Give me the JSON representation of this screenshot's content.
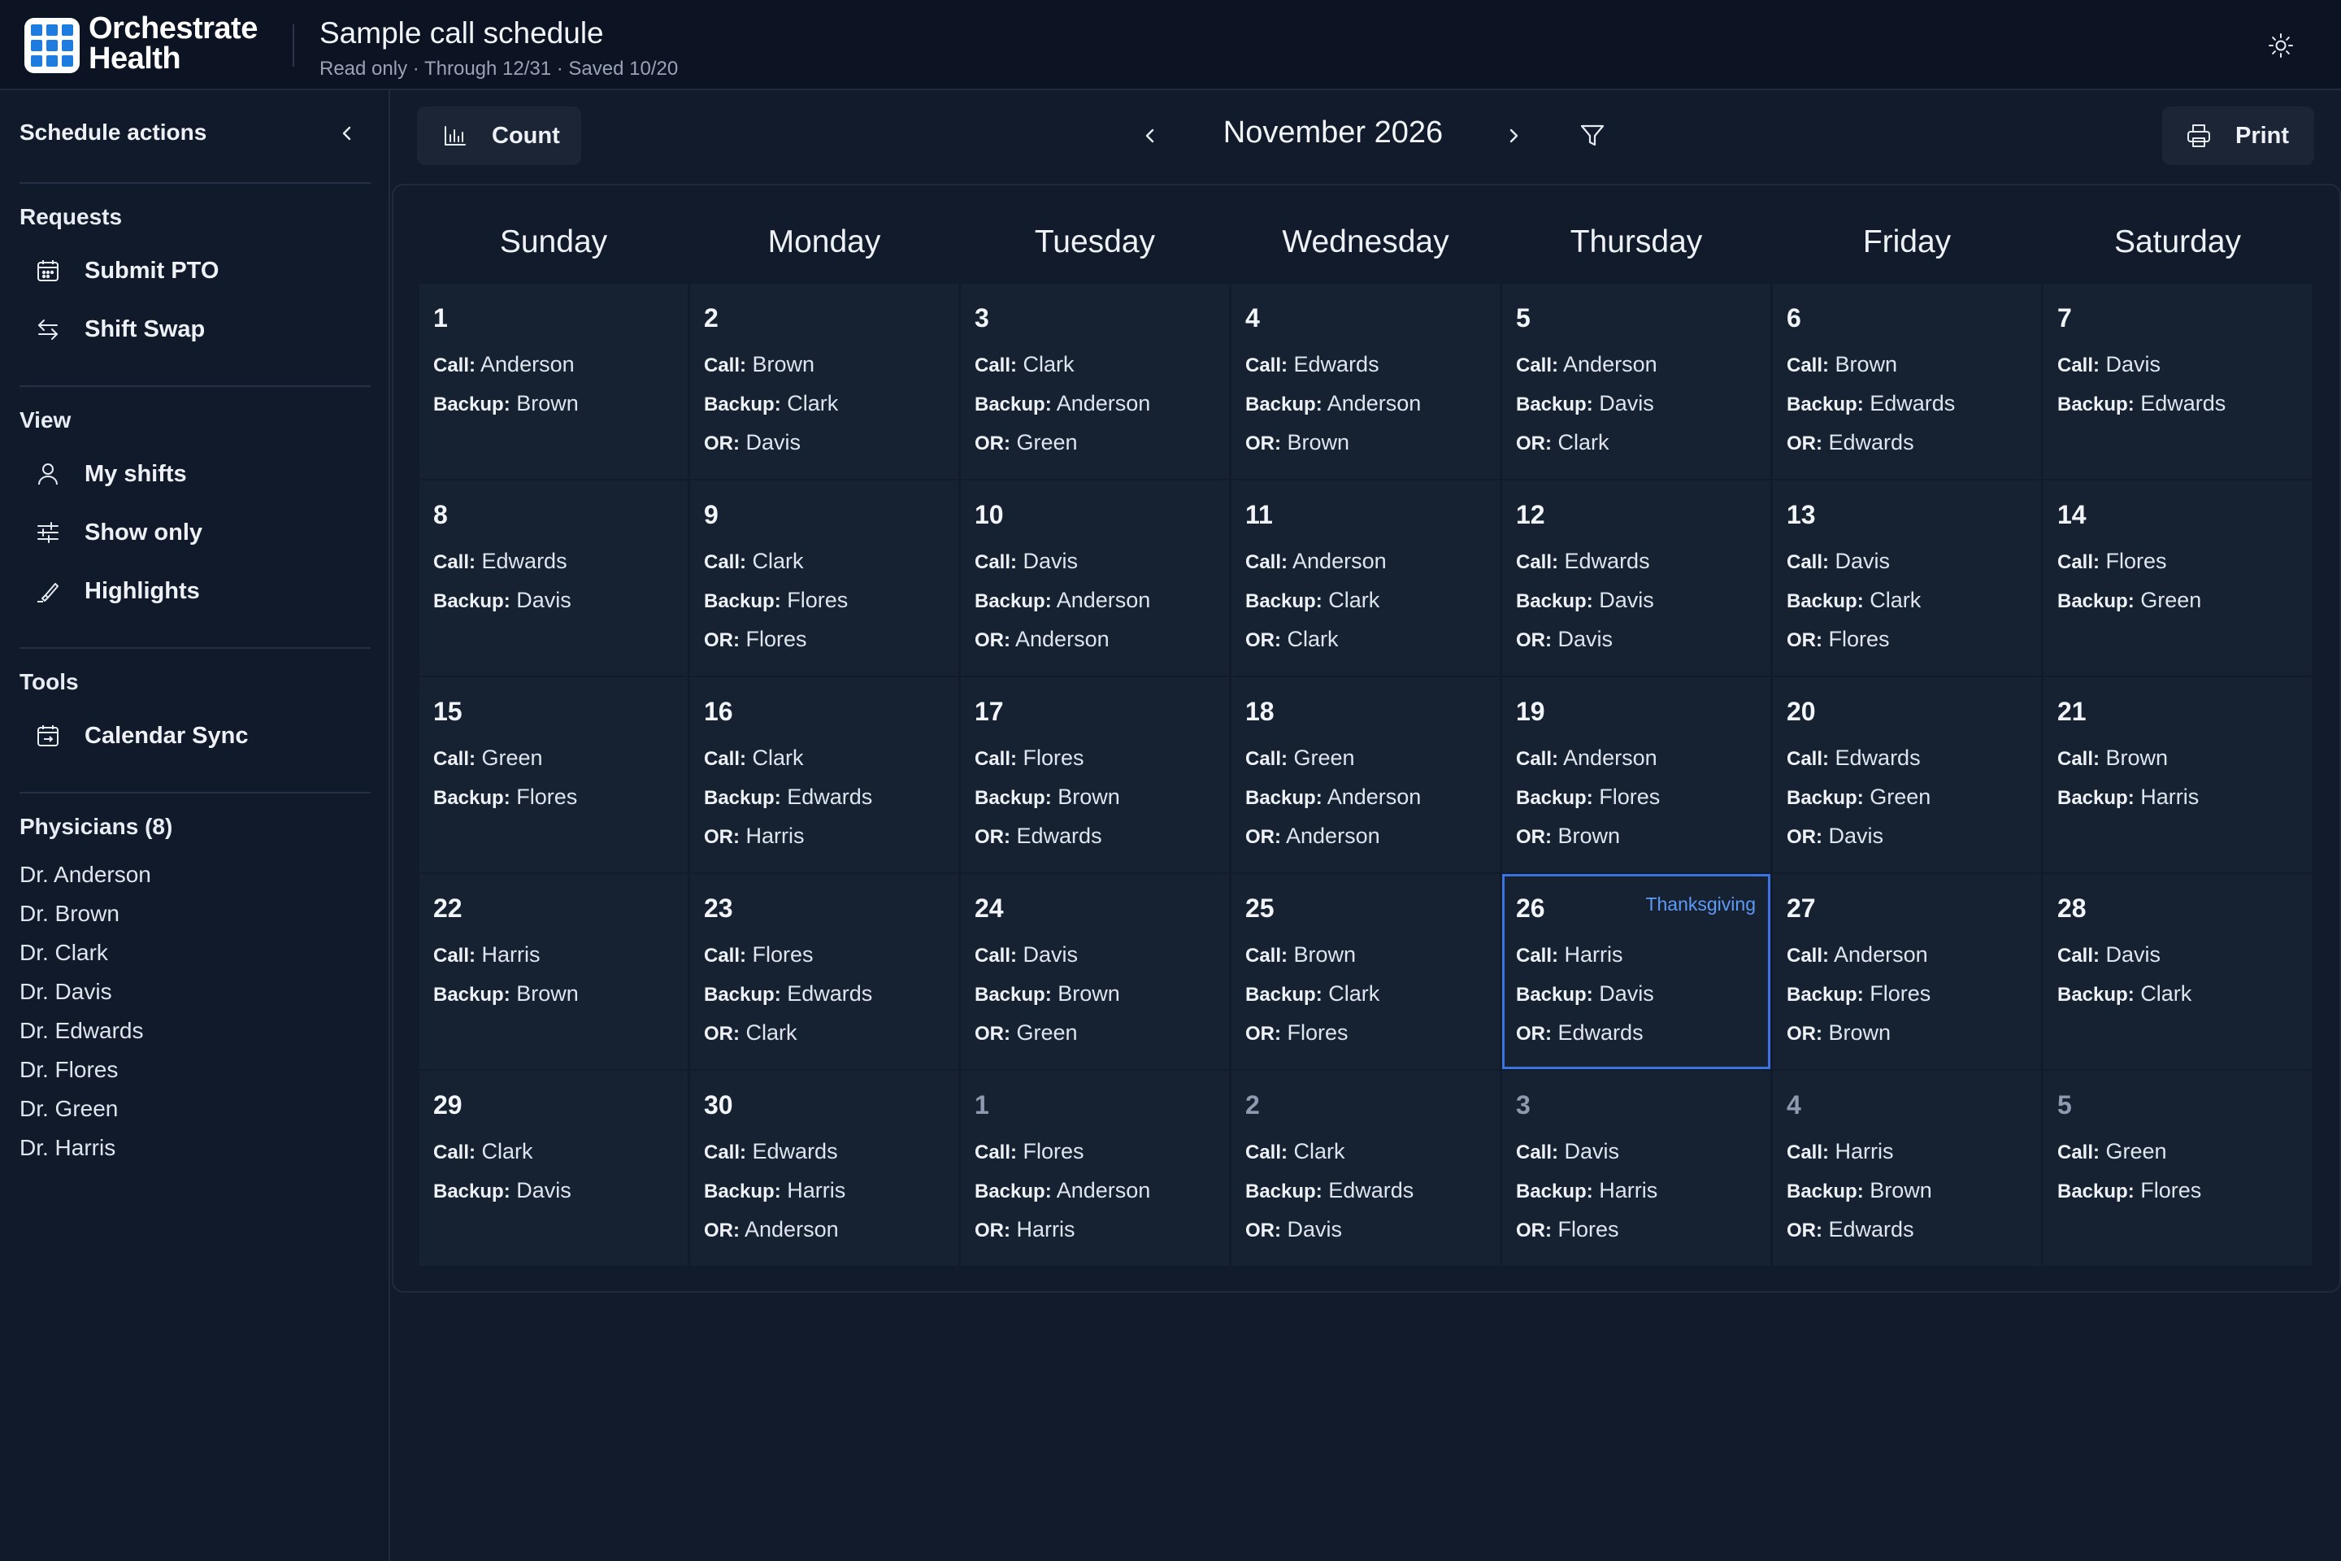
{
  "app": {
    "brand_line1": "Orchestrate",
    "brand_line2": "Health",
    "title": "Sample call schedule",
    "subtitle": "Read only · Through 12/31 · Saved 10/20",
    "theme_icon": "sun-icon"
  },
  "sidebar": {
    "heading": "Schedule actions",
    "requests": {
      "title": "Requests",
      "items": [
        {
          "label": "Submit PTO",
          "icon": "calendar-icon"
        },
        {
          "label": "Shift Swap",
          "icon": "swap-icon"
        }
      ]
    },
    "view": {
      "title": "View",
      "items": [
        {
          "label": "My shifts",
          "icon": "person-icon"
        },
        {
          "label": "Show only",
          "icon": "sliders-icon"
        },
        {
          "label": "Highlights",
          "icon": "highlighter-icon"
        }
      ]
    },
    "tools": {
      "title": "Tools",
      "items": [
        {
          "label": "Calendar Sync",
          "icon": "calendar-sync-icon"
        }
      ]
    },
    "physicians": {
      "title": "Physicians (8)",
      "list": [
        "Dr. Anderson",
        "Dr. Brown",
        "Dr. Clark",
        "Dr. Davis",
        "Dr. Edwards",
        "Dr. Flores",
        "Dr. Green",
        "Dr. Harris"
      ]
    }
  },
  "toolbar": {
    "count_label": "Count",
    "month_label": "November 2026",
    "print_label": "Print"
  },
  "calendar": {
    "weekdays": [
      "Sunday",
      "Monday",
      "Tuesday",
      "Wednesday",
      "Thursday",
      "Friday",
      "Saturday"
    ],
    "role_labels": {
      "call": "Call:",
      "backup": "Backup:",
      "or": "OR:"
    },
    "weeks": [
      [
        {
          "day": "1",
          "call": "Anderson",
          "backup": "Brown"
        },
        {
          "day": "2",
          "call": "Brown",
          "backup": "Clark",
          "or": "Davis"
        },
        {
          "day": "3",
          "call": "Clark",
          "backup": "Anderson",
          "or": "Green"
        },
        {
          "day": "4",
          "call": "Edwards",
          "backup": "Anderson",
          "or": "Brown"
        },
        {
          "day": "5",
          "call": "Anderson",
          "backup": "Davis",
          "or": "Clark"
        },
        {
          "day": "6",
          "call": "Brown",
          "backup": "Edwards",
          "or": "Edwards"
        },
        {
          "day": "7",
          "call": "Davis",
          "backup": "Edwards"
        }
      ],
      [
        {
          "day": "8",
          "call": "Edwards",
          "backup": "Davis"
        },
        {
          "day": "9",
          "call": "Clark",
          "backup": "Flores",
          "or": "Flores"
        },
        {
          "day": "10",
          "call": "Davis",
          "backup": "Anderson",
          "or": "Anderson"
        },
        {
          "day": "11",
          "call": "Anderson",
          "backup": "Clark",
          "or": "Clark"
        },
        {
          "day": "12",
          "call": "Edwards",
          "backup": "Davis",
          "or": "Davis"
        },
        {
          "day": "13",
          "call": "Davis",
          "backup": "Clark",
          "or": "Flores"
        },
        {
          "day": "14",
          "call": "Flores",
          "backup": "Green"
        }
      ],
      [
        {
          "day": "15",
          "call": "Green",
          "backup": "Flores"
        },
        {
          "day": "16",
          "call": "Clark",
          "backup": "Edwards",
          "or": "Harris"
        },
        {
          "day": "17",
          "call": "Flores",
          "backup": "Brown",
          "or": "Edwards"
        },
        {
          "day": "18",
          "call": "Green",
          "backup": "Anderson",
          "or": "Anderson"
        },
        {
          "day": "19",
          "call": "Anderson",
          "backup": "Flores",
          "or": "Brown"
        },
        {
          "day": "20",
          "call": "Edwards",
          "backup": "Green",
          "or": "Davis"
        },
        {
          "day": "21",
          "call": "Brown",
          "backup": "Harris"
        }
      ],
      [
        {
          "day": "22",
          "call": "Harris",
          "backup": "Brown"
        },
        {
          "day": "23",
          "call": "Flores",
          "backup": "Edwards",
          "or": "Clark"
        },
        {
          "day": "24",
          "call": "Davis",
          "backup": "Brown",
          "or": "Green"
        },
        {
          "day": "25",
          "call": "Brown",
          "backup": "Clark",
          "or": "Flores"
        },
        {
          "day": "26",
          "call": "Harris",
          "backup": "Davis",
          "or": "Edwards",
          "holiday": "Thanksgiving",
          "today": true
        },
        {
          "day": "27",
          "call": "Anderson",
          "backup": "Flores",
          "or": "Brown"
        },
        {
          "day": "28",
          "call": "Davis",
          "backup": "Clark"
        }
      ],
      [
        {
          "day": "29",
          "call": "Clark",
          "backup": "Davis"
        },
        {
          "day": "30",
          "call": "Edwards",
          "backup": "Harris",
          "or": "Anderson"
        },
        {
          "day": "1",
          "call": "Flores",
          "backup": "Anderson",
          "or": "Harris",
          "other_month": true
        },
        {
          "day": "2",
          "call": "Clark",
          "backup": "Edwards",
          "or": "Davis",
          "other_month": true
        },
        {
          "day": "3",
          "call": "Davis",
          "backup": "Harris",
          "or": "Flores",
          "other_month": true
        },
        {
          "day": "4",
          "call": "Harris",
          "backup": "Brown",
          "or": "Edwards",
          "other_month": true
        },
        {
          "day": "5",
          "call": "Green",
          "backup": "Flores",
          "other_month": true
        }
      ]
    ]
  }
}
